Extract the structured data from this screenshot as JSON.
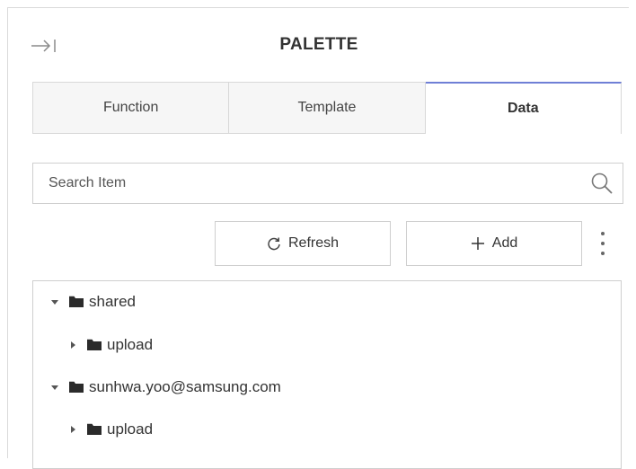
{
  "panel": {
    "title": "PALETTE",
    "collapse_icon": "collapse-right-arrow-icon"
  },
  "tabs": [
    {
      "label": "Function",
      "active": false
    },
    {
      "label": "Template",
      "active": false
    },
    {
      "label": "Data",
      "active": true
    }
  ],
  "search": {
    "placeholder": "Search Item",
    "value": "",
    "icon": "search-icon"
  },
  "toolbar": {
    "refresh_label": "Refresh",
    "refresh_icon": "refresh-icon",
    "add_label": "Add",
    "add_icon": "plus-icon",
    "more_icon": "more-vertical-icon"
  },
  "tree": {
    "items": [
      {
        "label": "shared",
        "expanded": true,
        "level": 0
      },
      {
        "label": "upload",
        "expanded": false,
        "level": 1
      },
      {
        "label": "sunhwa.yoo@samsung.com",
        "expanded": true,
        "level": 0
      },
      {
        "label": "upload",
        "expanded": false,
        "level": 1
      }
    ]
  },
  "colors": {
    "active_tab_accent": "#6f7fd6",
    "folder": "#2b2b2b",
    "border": "#cfcfcf",
    "inactive_tab_bg": "#f6f6f6"
  }
}
